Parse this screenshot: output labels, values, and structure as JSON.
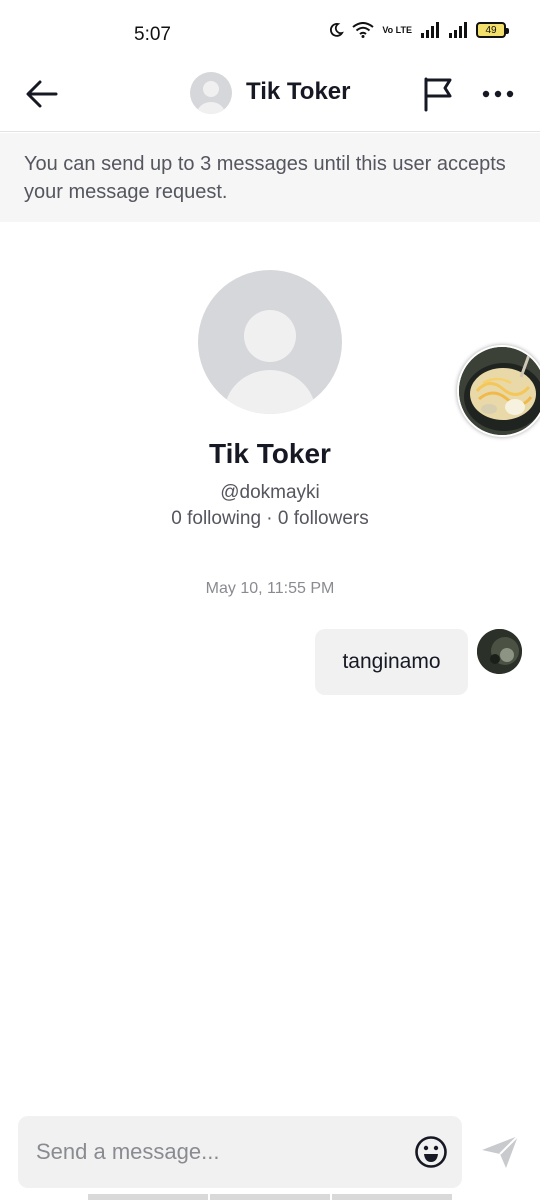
{
  "status_bar": {
    "time": "5:07",
    "network": "Vo LTE",
    "battery": "49",
    "icons": [
      "moon-icon",
      "wifi-icon",
      "volte-icon",
      "signal-icon",
      "signal-icon",
      "battery-icon"
    ]
  },
  "header": {
    "title": "Tik Toker",
    "icons": [
      "back-arrow-icon",
      "avatar-placeholder-icon",
      "flag-icon",
      "more-icon"
    ]
  },
  "notice": {
    "text": "You can send up to 3 messages until this user accepts your message request."
  },
  "profile": {
    "name": "Tik Toker",
    "handle": "@dokmayki",
    "stats": "0 following · 0 followers"
  },
  "conversation": {
    "timestamp": "May 10, 11:55 PM",
    "messages": [
      {
        "from": "me",
        "text": "tanginamo"
      }
    ]
  },
  "composer": {
    "placeholder": "Send a message...",
    "icons": [
      "emoji-icon",
      "send-icon"
    ]
  },
  "colors": {
    "text_primary": "#161823",
    "text_secondary": "#55565e",
    "notice_bg": "#f6f6f7",
    "bubble_bg": "#f1f1f2",
    "avatar_placeholder": "#d6d7da"
  }
}
